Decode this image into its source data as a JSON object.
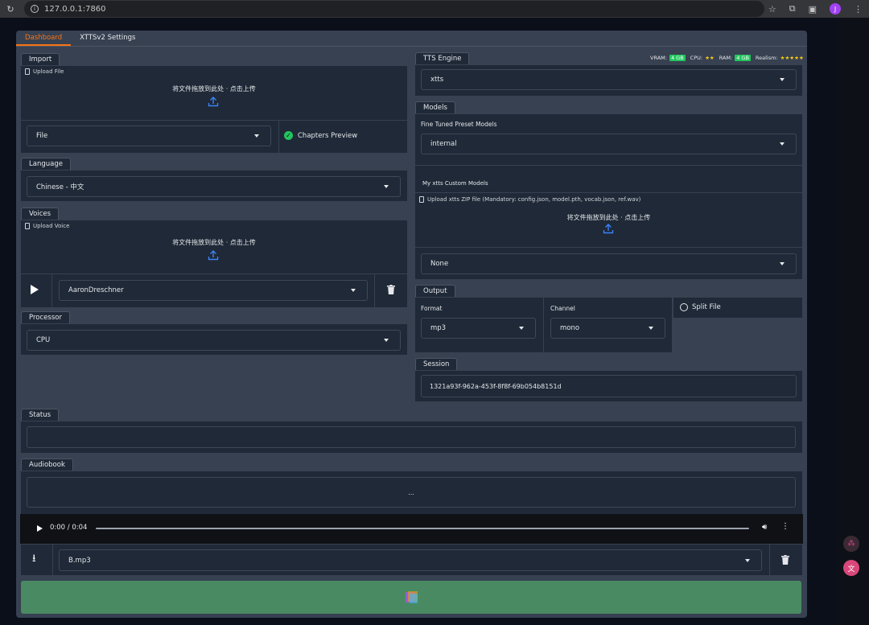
{
  "browser": {
    "url": "127.0.0.1:7860",
    "avatar_letter": "J"
  },
  "tabs": [
    {
      "label": "Dashboard",
      "active": true
    },
    {
      "label": "XTTSv2 Settings",
      "active": false
    }
  ],
  "import": {
    "label": "Import",
    "upload_hint": "Upload File",
    "drop_text": "将文件拖放到此处 · 点击上传",
    "file_type": "File",
    "chapters_preview": "Chapters Preview",
    "chapters_checked": true
  },
  "language": {
    "label": "Language",
    "value": "Chinese - 中文"
  },
  "voices": {
    "label": "Voices",
    "upload_hint": "Upload Voice",
    "drop_text": "将文件拖放到此处 · 点击上传",
    "value": "AaronDreschner"
  },
  "processor": {
    "label": "Processor",
    "value": "CPU"
  },
  "tts_engine": {
    "label": "TTS Engine",
    "value": "xtts",
    "vram_label": "VRAM:",
    "vram_badge": "4 GB",
    "cpu_label": "CPU:",
    "cpu_stars": "★★",
    "ram_label": "RAM:",
    "ram_badge": "4 GB",
    "realism_label": "Realism:",
    "realism_stars": "★★★★★"
  },
  "models": {
    "label": "Models",
    "fine_tuned_label": "Fine Tuned Preset Models",
    "fine_tuned_value": "internal",
    "custom_label": "My xtts Custom Models",
    "upload_hint": "Upload xtts ZIP file (Mandatory: config.json, model.pth, vocab.json, ref.wav)",
    "drop_text": "将文件拖放到此处 · 点击上传",
    "custom_value": "None"
  },
  "output": {
    "label": "Output",
    "format_label": "Format",
    "format_value": "mp3",
    "channel_label": "Channel",
    "channel_value": "mono",
    "split_file": "Split File",
    "split_checked": false
  },
  "session": {
    "label": "Session",
    "value": "1321a93f-962a-453f-8f8f-69b054b8151d"
  },
  "status": {
    "label": "Status",
    "value": ""
  },
  "audiobook": {
    "label": "Audiobook",
    "text_value": "...",
    "time": "0:00 / 0:04",
    "file_value": "B.mp3"
  },
  "colors": {
    "accent": "#f97316",
    "panel": "#1f2937",
    "app_bg": "#374151",
    "submit": "#4a8a63",
    "badge": "#22c55e",
    "stars": "#facc15"
  }
}
